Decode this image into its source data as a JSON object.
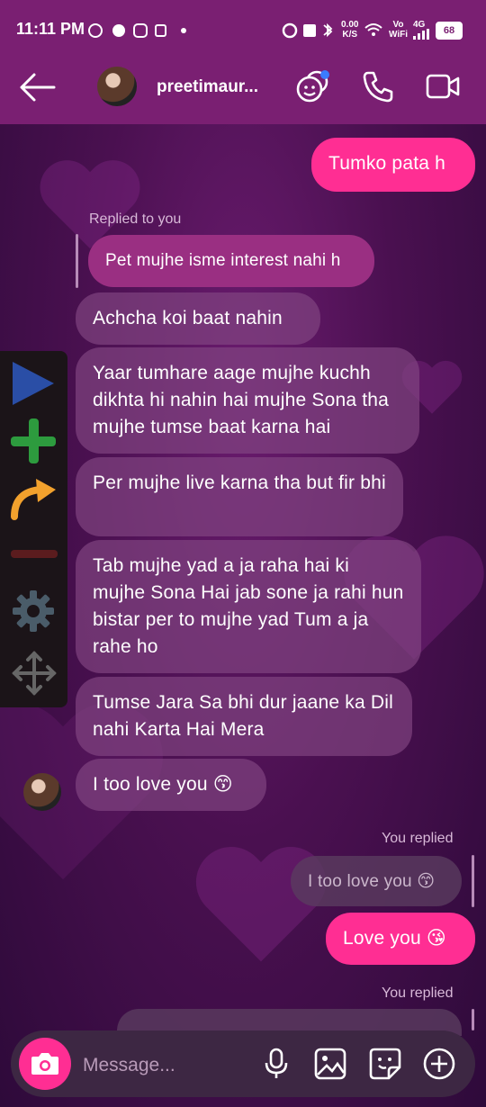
{
  "status_bar": {
    "time": "11:11 PM",
    "data_rate_value": "0.00",
    "data_rate_unit": "K/S",
    "vowifi_top": "Vo",
    "vowifi_bottom": "WiFi",
    "network": "4G",
    "battery": "68"
  },
  "header": {
    "contact_name": "preetimaur..."
  },
  "messages": {
    "m1_out": "Tumko pata h",
    "reply_label_1": "Replied to you",
    "quoted_1": "Pet mujhe isme interest nahi h",
    "m2": "Achcha koi baat nahin",
    "m3": "Yaar tumhare aage mujhe kuchh dikhta hi nahin hai mujhe Sona tha mujhe tumse baat karna hai",
    "m4": "Per mujhe live karna tha but fir bhi",
    "m5": "Tab mujhe yad a ja raha hai ki mujhe Sona Hai jab sone ja rahi hun bistar per to mujhe yad Tum a ja rahe ho",
    "m6": "Tumse Jara Sa bhi dur jaane ka Dil nahi Karta Hai Mera",
    "m7": "I too love you 😙",
    "reply_label_2": "You replied",
    "quoted_2": "I too love you 😙",
    "m8_out": "Love you 😘",
    "reply_label_3": "You replied"
  },
  "composer": {
    "placeholder": "Message..."
  },
  "colors": {
    "accent": "#ff2e93",
    "header_bg": "#7a1f72",
    "incoming_bubble": "#82468e"
  }
}
